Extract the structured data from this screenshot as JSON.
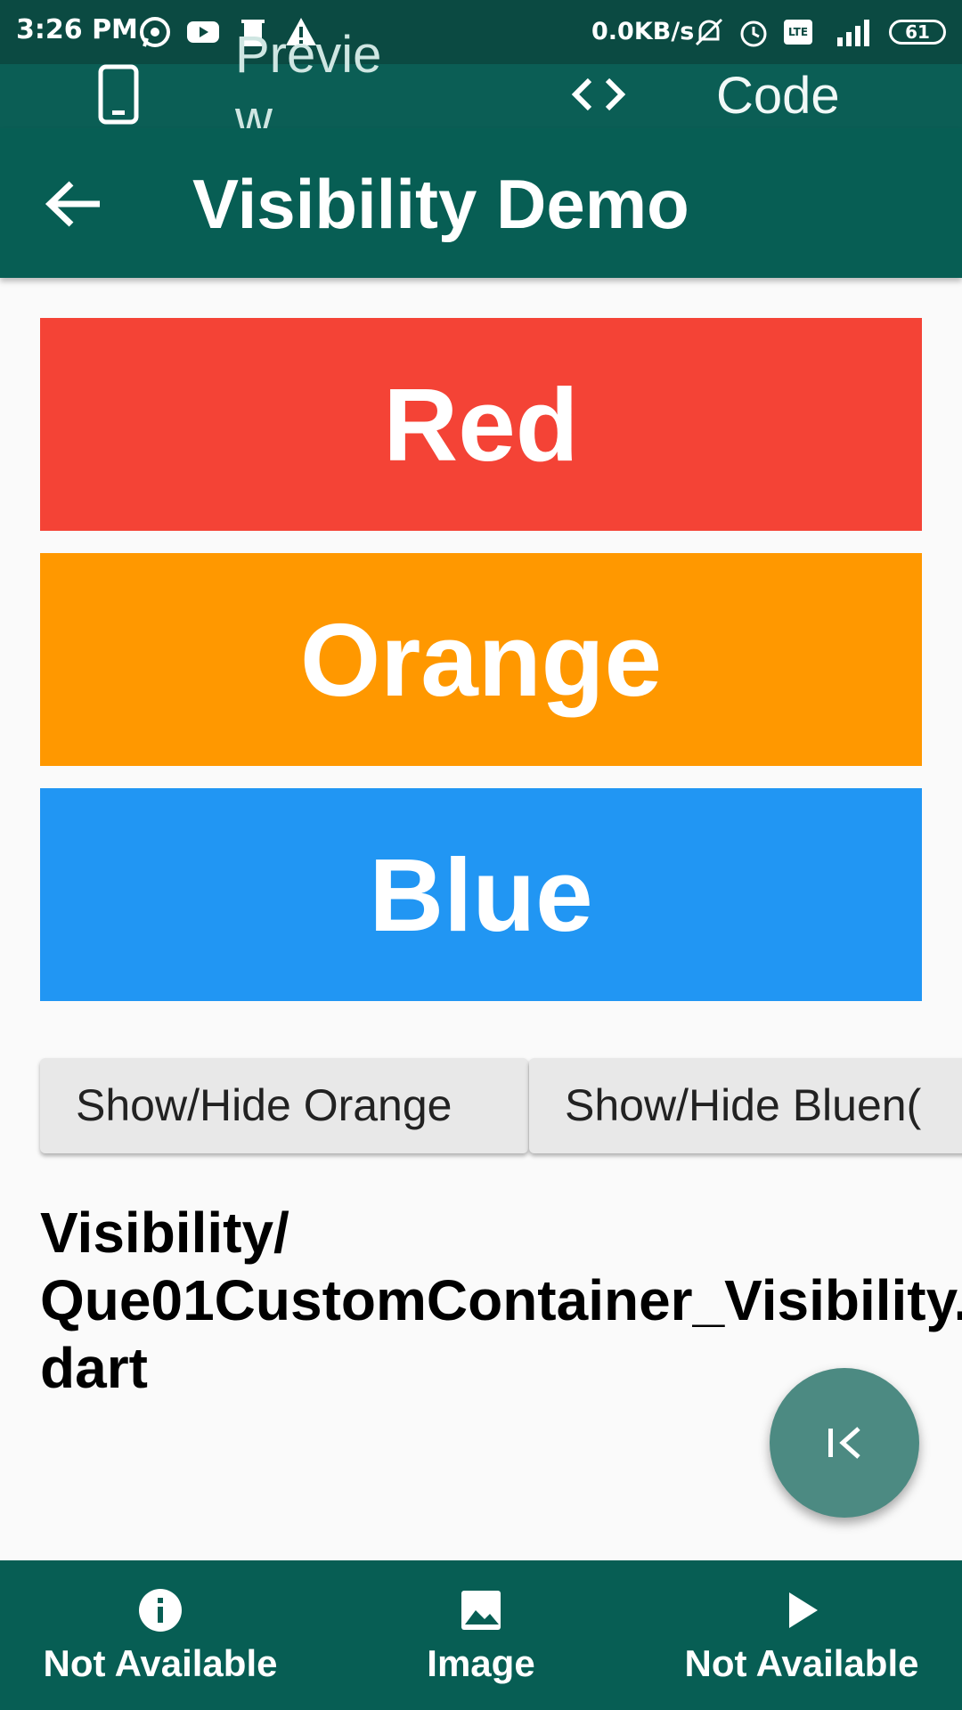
{
  "status_bar": {
    "time": "3:26 PM",
    "network_speed": "0.0KB/s",
    "battery": "61",
    "icons": [
      "whatsapp-icon",
      "youtube-icon",
      "trash-icon",
      "warning-icon",
      "mute-icon",
      "alarm-icon",
      "volte-icon",
      "signal-icon",
      "battery-icon"
    ]
  },
  "toggle_bar": {
    "preview_label": "Preview",
    "code_label": "Code"
  },
  "app_bar": {
    "title": "Visibility Demo"
  },
  "color_boxes": [
    {
      "label": "Red",
      "color": "#f44336"
    },
    {
      "label": "Orange",
      "color": "#ff9800"
    },
    {
      "label": "Blue",
      "color": "#2196f3"
    }
  ],
  "buttons": {
    "orange": "Show/Hide Orange",
    "blue": "Show/Hide Bluen("
  },
  "path_text": "Visibility/ Que01CustomContainer_Visibility. dart",
  "bottom_nav": {
    "items": [
      {
        "label": "Not Available",
        "icon": "info-icon"
      },
      {
        "label": "Image",
        "icon": "image-icon"
      },
      {
        "label": "Not Available",
        "icon": "play-icon"
      }
    ]
  },
  "colors": {
    "primary": "#075e54",
    "status_bar": "#0b4a42",
    "fab": "#4c8a82"
  }
}
